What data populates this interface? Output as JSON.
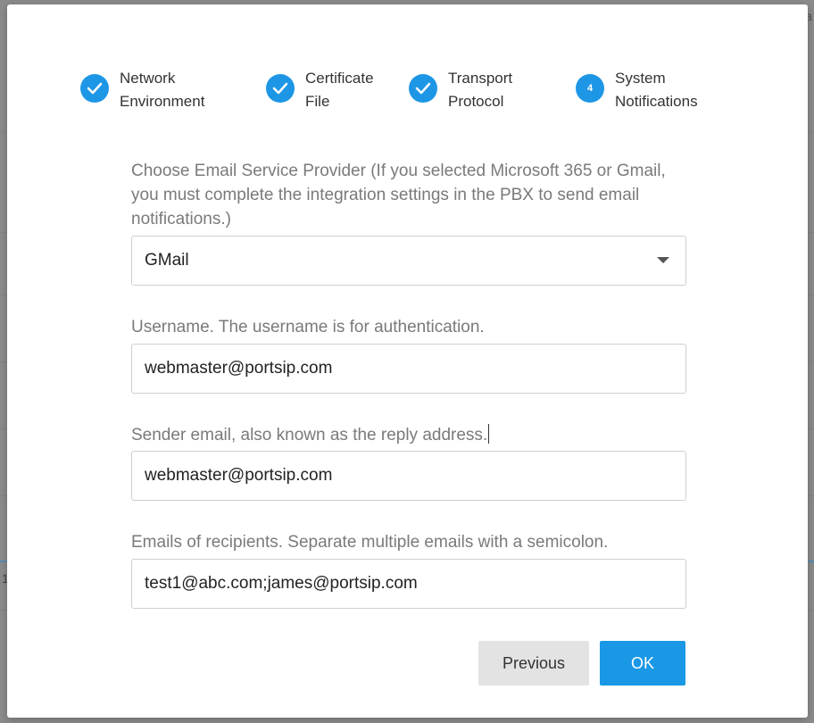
{
  "background": {
    "partial_text_left": "1",
    "partial_text_right": "a"
  },
  "stepper": {
    "steps": [
      {
        "line1": "Network",
        "line2": "Environment",
        "state": "done",
        "icon": "check-icon"
      },
      {
        "line1": "Certificate",
        "line2": "File",
        "state": "done",
        "icon": "check-icon"
      },
      {
        "line1": "Transport",
        "line2": "Protocol",
        "state": "done",
        "icon": "check-icon"
      },
      {
        "line1": "System",
        "line2": "Notifications",
        "state": "active",
        "number": "4"
      }
    ]
  },
  "form": {
    "provider": {
      "label": "Choose Email Service Provider (If you selected Microsoft 365 or Gmail, you must complete the integration settings in the PBX to send email notifications.)",
      "value": "GMail"
    },
    "username": {
      "label": "Username. The username is for authentication.",
      "value": "webmaster@portsip.com"
    },
    "sender": {
      "label": "Sender email, also known as the reply address.",
      "value": "webmaster@portsip.com"
    },
    "recipients": {
      "label": "Emails of recipients. Separate multiple emails with a semicolon.",
      "value": "test1@abc.com;james@portsip.com"
    }
  },
  "buttons": {
    "previous": "Previous",
    "ok": "OK"
  },
  "colors": {
    "accent": "#1a98e5",
    "step_circle": "#1e96e6",
    "secondary_button": "#e3e3e3",
    "label_text": "#7a7a7a"
  }
}
